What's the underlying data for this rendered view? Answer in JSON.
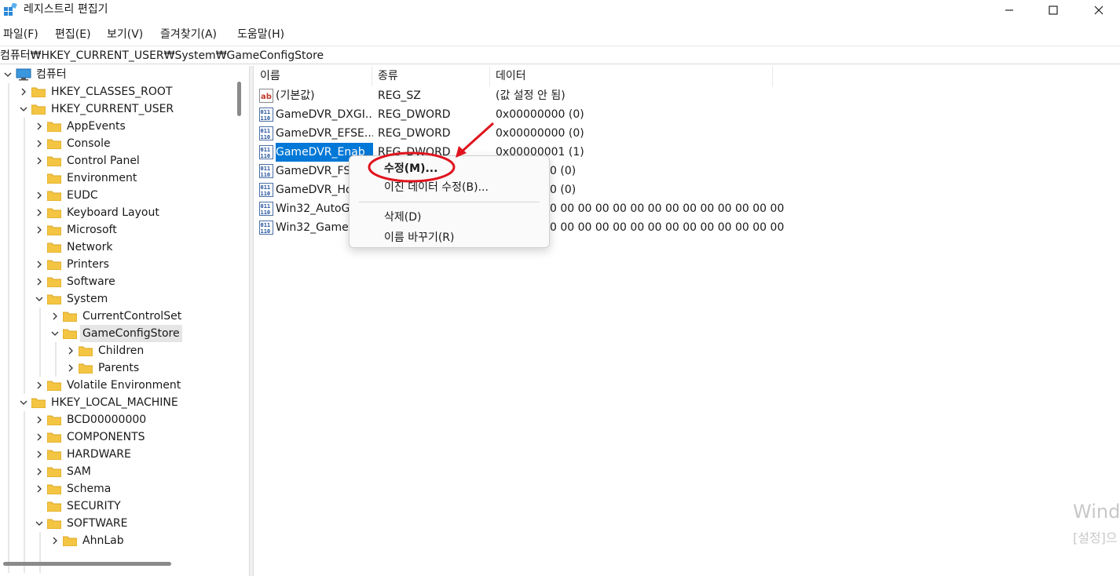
{
  "window": {
    "title": "레지스트리 편집기"
  },
  "menu": [
    "파일(F)",
    "편집(E)",
    "보기(V)",
    "즐겨찾기(A)",
    "도움말(H)"
  ],
  "address": "컴퓨터₩HKEY_CURRENT_USER₩System₩GameConfigStore",
  "tree": [
    {
      "label": "컴퓨터"
    },
    {
      "label": "HKEY_CLASSES_ROOT"
    },
    {
      "label": "HKEY_CURRENT_USER"
    },
    {
      "label": "AppEvents"
    },
    {
      "label": "Console"
    },
    {
      "label": "Control Panel"
    },
    {
      "label": "Environment"
    },
    {
      "label": "EUDC"
    },
    {
      "label": "Keyboard Layout"
    },
    {
      "label": "Microsoft"
    },
    {
      "label": "Network"
    },
    {
      "label": "Printers"
    },
    {
      "label": "Software"
    },
    {
      "label": "System"
    },
    {
      "label": "CurrentControlSet"
    },
    {
      "label": "GameConfigStore"
    },
    {
      "label": "Children"
    },
    {
      "label": "Parents"
    },
    {
      "label": "Volatile Environment"
    },
    {
      "label": "HKEY_LOCAL_MACHINE"
    },
    {
      "label": "BCD00000000"
    },
    {
      "label": "COMPONENTS"
    },
    {
      "label": "HARDWARE"
    },
    {
      "label": "SAM"
    },
    {
      "label": "Schema"
    },
    {
      "label": "SECURITY"
    },
    {
      "label": "SOFTWARE"
    },
    {
      "label": "AhnLab"
    }
  ],
  "columns": {
    "name": "이름",
    "type": "종류",
    "data": "데이터"
  },
  "values": [
    {
      "name": "(기본값)",
      "type": "REG_SZ",
      "data": "(값 설정 안 됨)",
      "icon": "string-value-icon"
    },
    {
      "name": "GameDVR_DXGI...",
      "type": "REG_DWORD",
      "data": "0x00000000 (0)",
      "icon": "binary-value-icon"
    },
    {
      "name": "GameDVR_EFSE...",
      "type": "REG_DWORD",
      "data": "0x00000000 (0)",
      "icon": "binary-value-icon"
    },
    {
      "name": "GameDVR_Enab",
      "type": "REG_DWORD",
      "data": "0x00000001 (1)",
      "icon": "binary-value-icon"
    },
    {
      "name": "GameDVR_FS",
      "type": "",
      "data": "0 (0)",
      "icon": "binary-value-icon"
    },
    {
      "name": "GameDVR_Ho",
      "type": "",
      "data": "0 (0)",
      "icon": "binary-value-icon"
    },
    {
      "name": "Win32_AutoG",
      "type": "",
      "data": "0 00 00 00 00 00 00 00 00 00 00 00 00 00 ...",
      "icon": "binary-value-icon"
    },
    {
      "name": "Win32_GameI",
      "type": "",
      "data": "0 00 00 00 00 00 00 00 00 00 00 00 00 00 ...",
      "icon": "binary-value-icon"
    }
  ],
  "context_menu": {
    "modify": "수정(M)...",
    "modify_binary": "이진 데이터 수정(B)...",
    "delete": "삭제(D)",
    "rename": "이름 바꾸기(R)"
  },
  "watermark": {
    "line1": "Wind",
    "line2": "[설정]으"
  },
  "colors": {
    "selection": "#0078d7",
    "annotation": "#e0141e",
    "folder": "#f4c542"
  }
}
